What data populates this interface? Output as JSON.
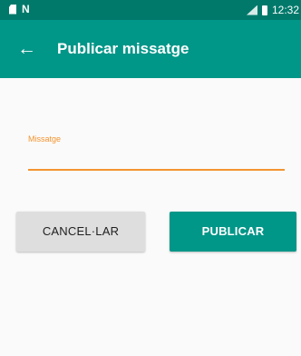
{
  "status_bar": {
    "time": "12:32",
    "left_icons": [
      "sd-card-icon",
      "n-icon"
    ],
    "right_icons": [
      "signal-icon",
      "battery-icon"
    ],
    "n_glyph": "N"
  },
  "app_bar": {
    "title": "Publicar missatge",
    "back_glyph": "←",
    "color": "#009688"
  },
  "form": {
    "field_label": "Missatge",
    "field_value": "",
    "accent_color": "#f3942f"
  },
  "buttons": {
    "cancel_label": "CANCEL·LAR",
    "publish_label": "PUBLICAR"
  }
}
